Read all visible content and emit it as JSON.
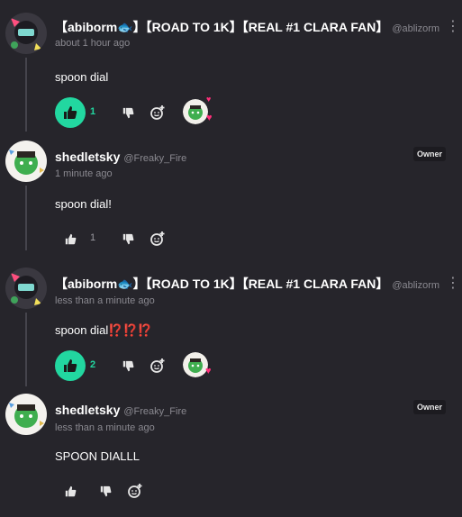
{
  "comments": [
    {
      "name": "【abiborm🐟】【ROAD TO 1K】【REAL #1 CLARA FAN】",
      "handle": "@ablizorm",
      "time": "about 1 hour ago",
      "text": "spoon dial",
      "likes": "1",
      "liked": true,
      "owner": ""
    },
    {
      "name": "shedletsky",
      "handle": "@Freaky_Fire",
      "time": "1 minute ago",
      "text": "spoon dial!",
      "likes": "1",
      "liked": false,
      "owner": "Owner"
    },
    {
      "name": "【abiborm🐟】【ROAD TO 1K】【REAL #1 CLARA FAN】",
      "handle": "@ablizorm",
      "time": "less than a minute ago",
      "text": "spoon dial⁉️⁉️⁉️",
      "likes": "2",
      "liked": true,
      "owner": ""
    },
    {
      "name": "shedletsky",
      "handle": "@Freaky_Fire",
      "time": "less than a minute ago",
      "text": "SPOON DIALLL",
      "likes": "",
      "liked": false,
      "owner": "Owner"
    }
  ],
  "icons": {
    "like": "thumbs-up-icon",
    "dislike": "thumbs-down-icon",
    "react": "add-reaction-icon",
    "more": "kebab-menu-icon"
  },
  "colors": {
    "background": "#26252b",
    "accent": "#22d7a0",
    "heart": "#ff2f7a"
  }
}
